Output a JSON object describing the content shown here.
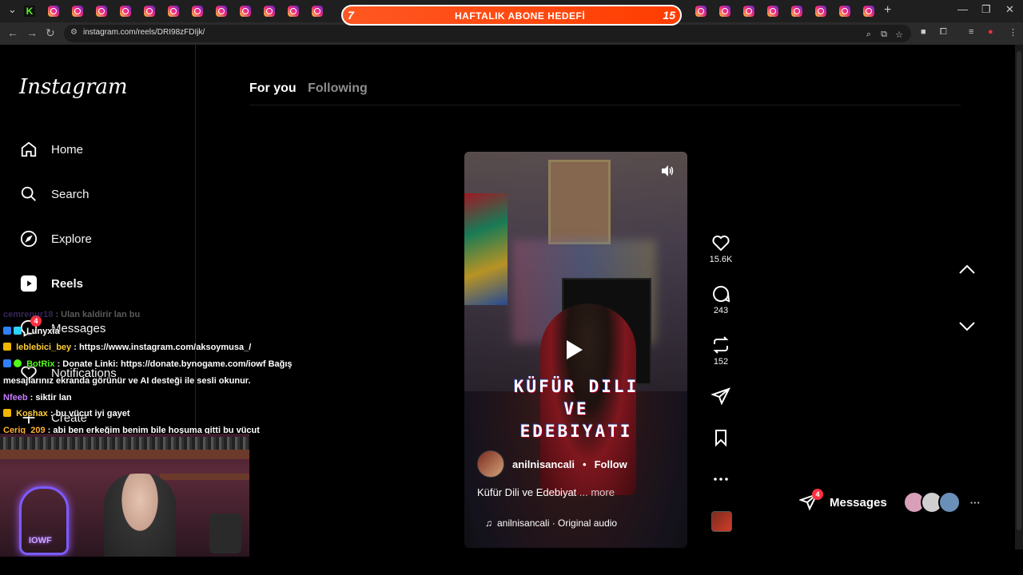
{
  "browser": {
    "url": "instagram.com/reels/DRI98zFDIjk/",
    "tab_icons": [
      "kick-icon",
      "instagram-icon",
      "youtube-icon"
    ],
    "new_tab": "+",
    "window_controls": {
      "minimize": "—",
      "restore": "❐",
      "close": "✕"
    }
  },
  "sub_goal": {
    "current": "7",
    "label": "HAFTALIK ABONE HEDEFİ",
    "target": "15"
  },
  "instagram": {
    "logo": "Instagram",
    "nav": [
      {
        "label": "Home",
        "icon": "home-icon"
      },
      {
        "label": "Search",
        "icon": "search-icon"
      },
      {
        "label": "Explore",
        "icon": "compass-icon"
      },
      {
        "label": "Reels",
        "icon": "reels-icon"
      },
      {
        "label": "Messages",
        "icon": "messenger-icon",
        "badge": "4"
      },
      {
        "label": "Notifications",
        "icon": "heart-icon"
      },
      {
        "label": "Create",
        "icon": "plus-icon"
      }
    ],
    "feed_tabs": {
      "for_you": "For you",
      "following": "Following"
    },
    "reel": {
      "overlay_title": [
        "KÜFÜR DILI",
        "VE",
        "EDEBIYATI"
      ],
      "author": "anilnisancali",
      "separator": "•",
      "follow": "Follow",
      "caption": "Küfür Dili ve Edebiyat",
      "more": "... more",
      "audio": "anilnisancali · Original audio"
    },
    "actions": {
      "likes": "15.6K",
      "comments": "243",
      "reposts": "152"
    },
    "messages_pill": {
      "label": "Messages",
      "badge": "4"
    }
  },
  "chat": [
    {
      "user": "cemrenur18",
      "text": ": Ulan kaldirir lan bu",
      "color": "#9c6bff",
      "faded": true
    },
    {
      "user": "Lunyxia",
      "text": "",
      "color": "#ffffff"
    },
    {
      "user": "leblebici_bey",
      "text": ": https://www.instagram.com/aksoymusa_/",
      "color": "#ffcc33"
    },
    {
      "user": "BotRix",
      "text": ": Donate Linki: https://donate.bynogame.com/iowf Bağış mesajlarınız ekranda görünür ve AI desteği ile sesli okunur.",
      "color": "#53fc18"
    },
    {
      "user": "Nfeeb",
      "text": ": siktir lan",
      "color": "#c77dff"
    },
    {
      "user": "Koshax",
      "text": ": bu vücut iyi gayet",
      "color": "#ffcc33"
    },
    {
      "user": "Cerig_209",
      "text": ": abi ben erkeğim benim bile hoşuma gitti bu vücut",
      "color": "#ffb030"
    }
  ],
  "webcam": {
    "neon_text": "IOWF"
  },
  "colors": {
    "accent": "#ff3d00",
    "badge": "#ff3040",
    "bg": "#000000"
  }
}
